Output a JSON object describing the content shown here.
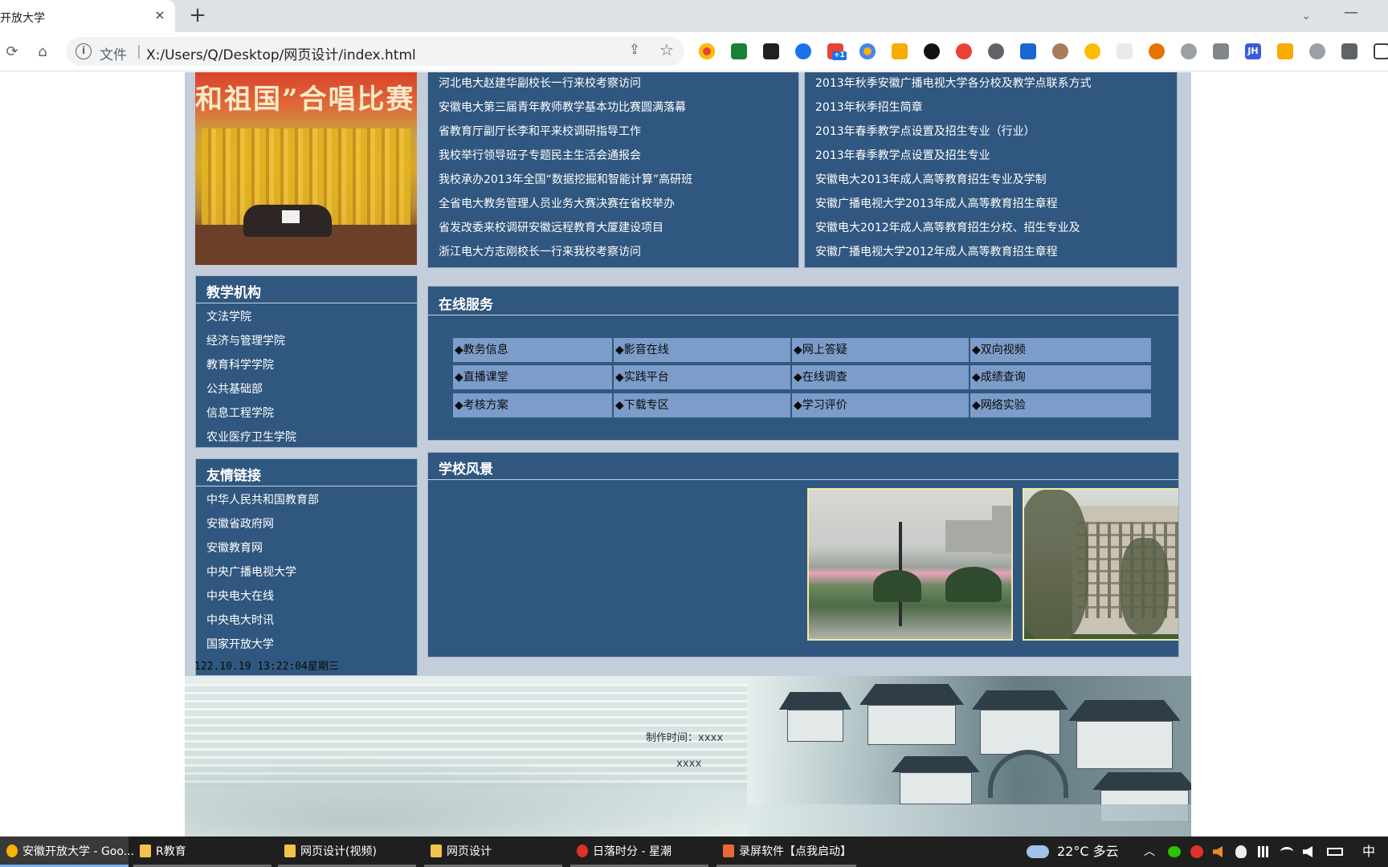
{
  "browser": {
    "tab_title": "开放大学",
    "tab_close": "×",
    "new_tab": "+",
    "tab_search": "⌄",
    "minimize": "—",
    "back": "⟳",
    "home": "⌂",
    "omnibox_info": "i",
    "omnibox_file": "文件",
    "omnibox_sep": "|",
    "url": "X:/Users/Q/Desktop/网页设计/index.html",
    "share": "⇪",
    "star": "☆",
    "extension_badge": "+1",
    "extension_jh": "JH"
  },
  "news": {
    "left": [
      "河北电大赵建华副校长一行来校考察访问",
      "安徽电大第三届青年教师教学基本功比赛圆满落幕",
      "省教育厅副厅长李和平来校调研指导工作",
      "我校举行领导班子专题民主生活会通报会",
      "我校承办2013年全国“数据挖掘和智能计算”高研班",
      "全省电大教务管理人员业务大赛决赛在省校举办",
      "省发改委来校调研安徽远程教育大厦建设项目",
      "浙江电大方志刚校长一行来我校考察访问"
    ],
    "right": [
      "2013年秋季安徽广播电视大学各分校及教学点联系方式",
      "2013年秋季招生简章",
      "2013年春季教学点设置及招生专业（行业）",
      "2013年春季教学点设置及招生专业",
      "安徽电大2013年成人高等教育招生专业及学制",
      "安徽广播电视大学2013年成人高等教育招生章程",
      "安徽电大2012年成人高等教育招生分校、招生专业及",
      "安徽广播电视大学2012年成人高等教育招生章程"
    ]
  },
  "photo": {
    "banner": "和祖国”合唱比赛"
  },
  "teaching": {
    "title": "教学机构",
    "items": [
      "文法学院",
      "经济与管理学院",
      "教育科学学院",
      "公共基础部",
      "信息工程学院",
      "农业医疗卫生学院"
    ]
  },
  "links": {
    "title": "友情链接",
    "items": [
      "中华人民共和国教育部",
      "安徽省政府网",
      "安徽教育网",
      "中央广播电视大学",
      "中央电大在线",
      "中央电大时讯",
      "国家开放大学"
    ]
  },
  "datetime": "122.10.19 13:22:04星期三",
  "services": {
    "title": "在线服务",
    "rows": [
      [
        "◆教务信息",
        "◆影音在线",
        "◆网上答疑",
        "◆双向视频"
      ],
      [
        "◆直播课堂",
        "◆实践平台",
        "◆在线调查",
        "◆成绩查询"
      ],
      [
        "◆考核方案",
        "◆下载专区",
        "◆学习评价",
        "◆网络实验"
      ]
    ]
  },
  "scenery": {
    "title": "学校风景"
  },
  "footer": {
    "made_time": "制作时间：xxxx",
    "line2": "xxxx"
  },
  "taskbar": {
    "items": [
      {
        "label": "安徽开放大学 - Goo...",
        "icon": "chrome-icon",
        "color": "#f4b400"
      },
      {
        "label": "R教育",
        "icon": "folder-icon",
        "color": "#f2c24b"
      },
      {
        "label": "网页设计(视频)",
        "icon": "folder-icon",
        "color": "#f2c24b"
      },
      {
        "label": "网页设计",
        "icon": "folder-icon",
        "color": "#f2c24b"
      },
      {
        "label": "日落时分 - 星潮",
        "icon": "music-icon",
        "color": "#e0302c"
      },
      {
        "label": "录屏软件【点我启动】",
        "icon": "recorder-icon",
        "color": "#e86a3a"
      }
    ],
    "weather": "22°C 多云",
    "ime": "中"
  }
}
